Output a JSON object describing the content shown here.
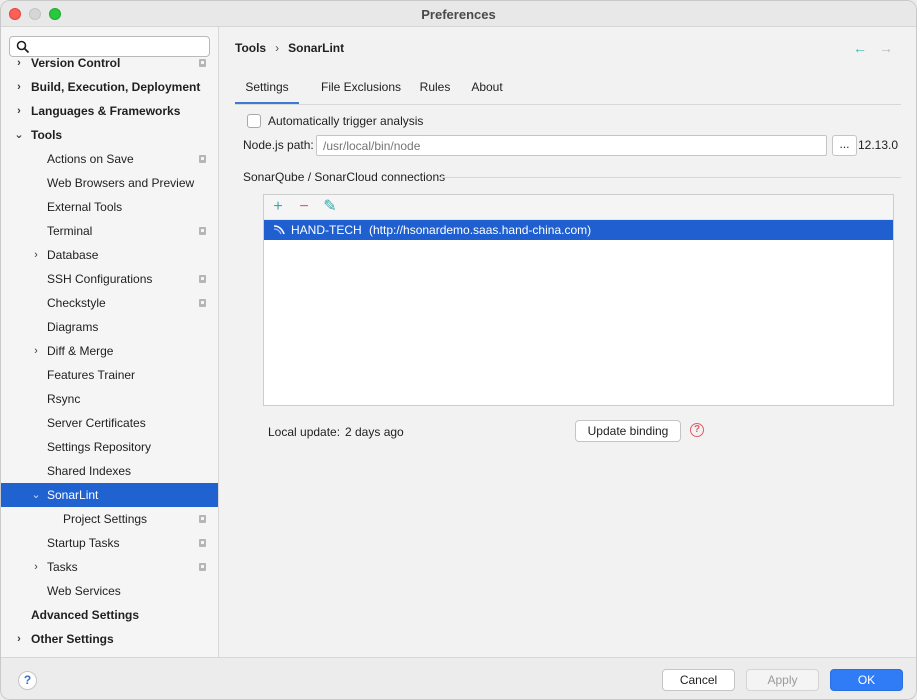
{
  "window": {
    "title": "Preferences"
  },
  "search": {
    "placeholder": "",
    "value": ""
  },
  "sidebar": {
    "items": [
      {
        "label": "Version Control",
        "level": 0,
        "bold": true,
        "arrow": "›",
        "proj": true
      },
      {
        "label": "Build, Execution, Deployment",
        "level": 0,
        "bold": true,
        "arrow": "›",
        "proj": false
      },
      {
        "label": "Languages & Frameworks",
        "level": 0,
        "bold": true,
        "arrow": "›",
        "proj": false
      },
      {
        "label": "Tools",
        "level": 0,
        "bold": true,
        "arrow": "⌄",
        "proj": false
      },
      {
        "label": "Actions on Save",
        "level": 1,
        "bold": false,
        "arrow": "",
        "proj": true
      },
      {
        "label": "Web Browsers and Preview",
        "level": 1,
        "bold": false,
        "arrow": "",
        "proj": false
      },
      {
        "label": "External Tools",
        "level": 1,
        "bold": false,
        "arrow": "",
        "proj": false
      },
      {
        "label": "Terminal",
        "level": 1,
        "bold": false,
        "arrow": "",
        "proj": true
      },
      {
        "label": "Database",
        "level": 1,
        "bold": false,
        "arrow": "›",
        "proj": false
      },
      {
        "label": "SSH Configurations",
        "level": 1,
        "bold": false,
        "arrow": "",
        "proj": true
      },
      {
        "label": "Checkstyle",
        "level": 1,
        "bold": false,
        "arrow": "",
        "proj": true
      },
      {
        "label": "Diagrams",
        "level": 1,
        "bold": false,
        "arrow": "",
        "proj": false
      },
      {
        "label": "Diff & Merge",
        "level": 1,
        "bold": false,
        "arrow": "›",
        "proj": false
      },
      {
        "label": "Features Trainer",
        "level": 1,
        "bold": false,
        "arrow": "",
        "proj": false
      },
      {
        "label": "Rsync",
        "level": 1,
        "bold": false,
        "arrow": "",
        "proj": false
      },
      {
        "label": "Server Certificates",
        "level": 1,
        "bold": false,
        "arrow": "",
        "proj": false
      },
      {
        "label": "Settings Repository",
        "level": 1,
        "bold": false,
        "arrow": "",
        "proj": false
      },
      {
        "label": "Shared Indexes",
        "level": 1,
        "bold": false,
        "arrow": "",
        "proj": false
      },
      {
        "label": "SonarLint",
        "level": 1,
        "bold": false,
        "arrow": "⌄",
        "proj": false,
        "selected": true
      },
      {
        "label": "Project Settings",
        "level": 2,
        "bold": false,
        "arrow": "",
        "proj": true
      },
      {
        "label": "Startup Tasks",
        "level": 1,
        "bold": false,
        "arrow": "",
        "proj": true
      },
      {
        "label": "Tasks",
        "level": 1,
        "bold": false,
        "arrow": "›",
        "proj": true
      },
      {
        "label": "Web Services",
        "level": 1,
        "bold": false,
        "arrow": "",
        "proj": false
      },
      {
        "label": "Advanced Settings",
        "level": 0,
        "bold": true,
        "arrow": "",
        "proj": false
      },
      {
        "label": "Other Settings",
        "level": 0,
        "bold": true,
        "arrow": "›",
        "proj": false
      }
    ]
  },
  "breadcrumb": {
    "parent": "Tools",
    "separator": "›",
    "current": "SonarLint"
  },
  "nav": {
    "back_icon": "←",
    "forward_icon": "→"
  },
  "tabs": [
    {
      "label": "Settings",
      "active": true
    },
    {
      "label": "File Exclusions",
      "active": false
    },
    {
      "label": "Rules",
      "active": false
    },
    {
      "label": "About",
      "active": false
    }
  ],
  "settings": {
    "auto_trigger_label": "Automatically trigger analysis",
    "auto_trigger_checked": false,
    "node_label": "Node.js path:",
    "node_placeholder": "/usr/local/bin/node",
    "browse_label": "...",
    "node_version": "12.13.0",
    "connections_title": "SonarQube / SonarCloud connections",
    "toolbar": {
      "add": "+",
      "remove": "−",
      "edit": "✎"
    },
    "connections": [
      {
        "name": "HAND-TECH",
        "url": "(http://hsonardemo.saas.hand-china.com)"
      }
    ],
    "local_update_label": "Local update:",
    "local_update_value": "2 days ago",
    "update_binding_label": "Update binding",
    "help_glyph": "?"
  },
  "footer": {
    "help_glyph": "?",
    "cancel_label": "Cancel",
    "apply_label": "Apply",
    "ok_label": "OK"
  },
  "colors": {
    "selection": "#2162d1",
    "accent_teal": "#3ba6a1",
    "remove_red": "#e55865",
    "ok_blue": "#2f7cf6"
  }
}
